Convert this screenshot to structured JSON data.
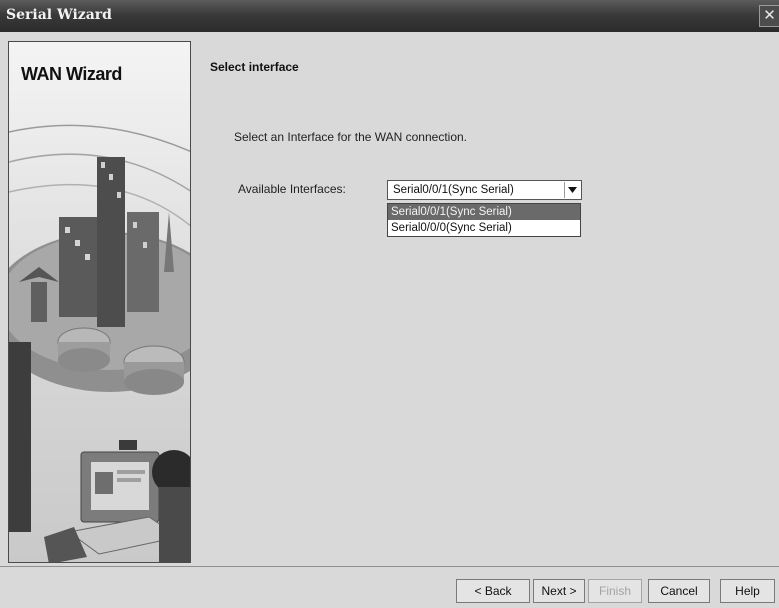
{
  "window": {
    "title": "Serial Wizard",
    "close_glyph": "✕"
  },
  "side_panel": {
    "title": "WAN Wizard"
  },
  "content": {
    "title": "Select interface",
    "instruction": "Select an Interface for the WAN connection.",
    "interfaces_label": "Available Interfaces:",
    "selected_interface": "Serial0/0/1(Sync Serial)",
    "options": [
      {
        "label": "Serial0/0/1(Sync Serial)",
        "selected": true
      },
      {
        "label": "Serial0/0/0(Sync Serial)",
        "selected": false
      }
    ]
  },
  "footer": {
    "back_label": "< Back",
    "next_label": "Next >",
    "finish_label": "Finish",
    "cancel_label": "Cancel",
    "help_label": "Help"
  },
  "icons": {
    "close": "close-icon",
    "dropdown": "chevron-down-icon"
  },
  "colors": {
    "titlebar": "#3a3a3a",
    "dialog_bg": "#d9d9d9",
    "selected_option": "#6a6a6a"
  }
}
